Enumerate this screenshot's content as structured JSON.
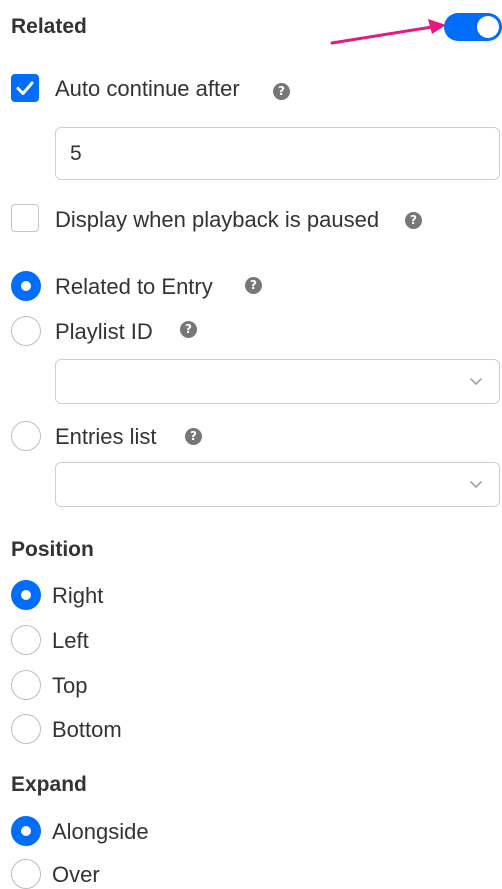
{
  "related": {
    "title": "Related",
    "toggle_on": true,
    "auto_continue": {
      "label": "Auto continue after",
      "checked": true,
      "help_icon": "question-circle-icon",
      "value": "5"
    },
    "display_paused": {
      "label": "Display when playback is paused",
      "checked": false,
      "help_icon": "question-circle-icon"
    },
    "source_options": [
      {
        "label": "Related to Entry",
        "selected": true,
        "has_help": true
      },
      {
        "label": "Playlist ID",
        "selected": false,
        "has_help": true,
        "select_value": ""
      },
      {
        "label": "Entries list",
        "selected": false,
        "has_help": true,
        "select_value": ""
      }
    ]
  },
  "position": {
    "title": "Position",
    "options": [
      {
        "label": "Right",
        "selected": true
      },
      {
        "label": "Left",
        "selected": false
      },
      {
        "label": "Top",
        "selected": false
      },
      {
        "label": "Bottom",
        "selected": false
      }
    ]
  },
  "expand": {
    "title": "Expand",
    "options": [
      {
        "label": "Alongside",
        "selected": true
      },
      {
        "label": "Over",
        "selected": false
      }
    ]
  },
  "colors": {
    "accent": "#006efa",
    "annotation_arrow": "#e6197f",
    "text": "#333333",
    "border": "#cfcfcf"
  }
}
